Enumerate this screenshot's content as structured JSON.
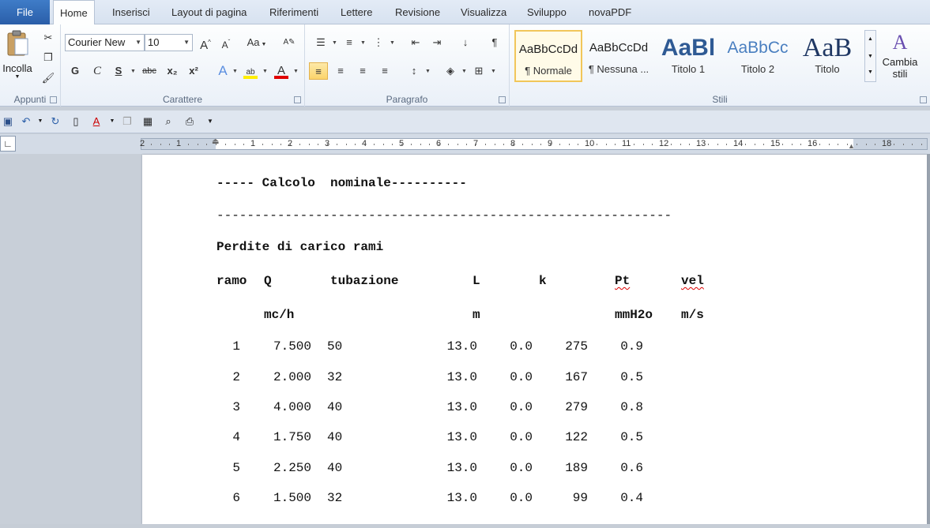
{
  "tabs": {
    "file": "File",
    "home": "Home",
    "insert": "Inserisci",
    "layout": "Layout di pagina",
    "references": "Riferimenti",
    "mailings": "Lettere",
    "review": "Revisione",
    "view": "Visualizza",
    "developer": "Sviluppo",
    "novapdf": "novaPDF"
  },
  "clipboard": {
    "paste_label": "Incolla",
    "group_label": "Appunti"
  },
  "font": {
    "name": "Courier New",
    "size": "10",
    "group_label": "Carattere",
    "bold": "G",
    "italic": "C",
    "underline": "S",
    "strike": "abc",
    "subscript": "x₂",
    "superscript": "x²",
    "case": "Aa",
    "grow": "A",
    "shrink": "A",
    "font_color": "A"
  },
  "paragraph": {
    "group_label": "Paragrafo",
    "show_marks": "¶"
  },
  "styles": {
    "group_label": "Stili",
    "items": [
      {
        "sample": "AaBbCcDd",
        "name": "¶ Normale"
      },
      {
        "sample": "AaBbCcDd",
        "name": "¶ Nessuna ..."
      },
      {
        "sample": "AaBl",
        "name": "Titolo 1"
      },
      {
        "sample": "AaBbCc",
        "name": "Titolo 2"
      },
      {
        "sample": "AaB",
        "name": "Titolo"
      }
    ],
    "change_styles": "Cambia stili"
  },
  "ruler": {
    "labels": [
      "2",
      "1",
      "1",
      "2",
      "3",
      "4",
      "5",
      "6",
      "7",
      "8",
      "9",
      "10",
      "11",
      "12",
      "13",
      "14",
      "15",
      "16",
      "18"
    ]
  },
  "document": {
    "section_title": "----- Calcolo  nominale----------",
    "separator": "------------------------------------------------------------",
    "subtitle": "Perdite di carico rami",
    "headers": [
      "ramo",
      "Q",
      "tubazione",
      "L",
      "k",
      "Pt",
      "vel"
    ],
    "units": [
      "mc/h",
      "m",
      "mmH2o",
      "m/s"
    ],
    "rows": [
      [
        "1",
        "7.500",
        "50",
        "13.0",
        "0.0",
        "275",
        "0.9"
      ],
      [
        "2",
        "2.000",
        "32",
        "13.0",
        "0.0",
        "167",
        "0.5"
      ],
      [
        "3",
        "4.000",
        "40",
        "13.0",
        "0.0",
        "279",
        "0.8"
      ],
      [
        "4",
        "1.750",
        "40",
        "13.0",
        "0.0",
        "122",
        "0.5"
      ],
      [
        "5",
        "2.250",
        "40",
        "13.0",
        "0.0",
        "189",
        "0.6"
      ],
      [
        "6",
        "1.500",
        "32",
        "13.0",
        "0.0",
        "99",
        "0.4"
      ]
    ]
  }
}
